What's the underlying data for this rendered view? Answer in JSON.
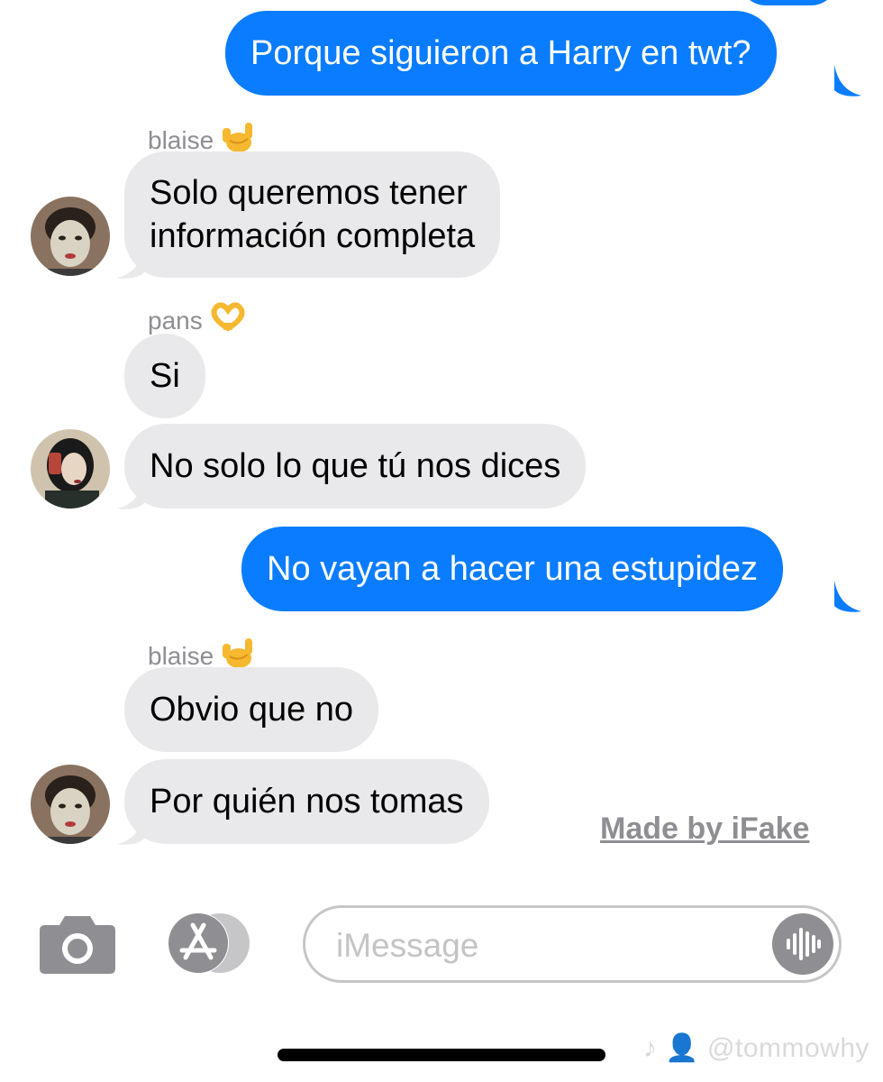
{
  "messages": {
    "m0_text": "Porque siguieron a Harry en twt?",
    "sender1": "blaise",
    "m1_text_line1": "Solo queremos tener",
    "m1_text_line2": "información completa",
    "sender2": "pans",
    "m2_text": "Si",
    "m3_text": "No solo lo que tú nos dices",
    "m4_text": "No vayan a hacer una estupidez",
    "sender3": "blaise",
    "m5_text": "Obvio que no",
    "m6_text": "Por quién nos tomas"
  },
  "icons": {
    "blaise_emoji": "call-me-hand-icon",
    "pans_emoji": "heart-hands-icon",
    "camera": "camera-icon",
    "app_store": "app-store-icon",
    "audio": "audio-waveform-icon"
  },
  "watermark": {
    "label": "Made by iFake"
  },
  "composer": {
    "placeholder": "iMessage"
  },
  "overlay": {
    "tiktok_handle": "@tommowhy"
  },
  "colors": {
    "outgoing_bubble": "#0a7cff",
    "incoming_bubble": "#e9e9eb",
    "secondary_text": "#8e8e93"
  }
}
